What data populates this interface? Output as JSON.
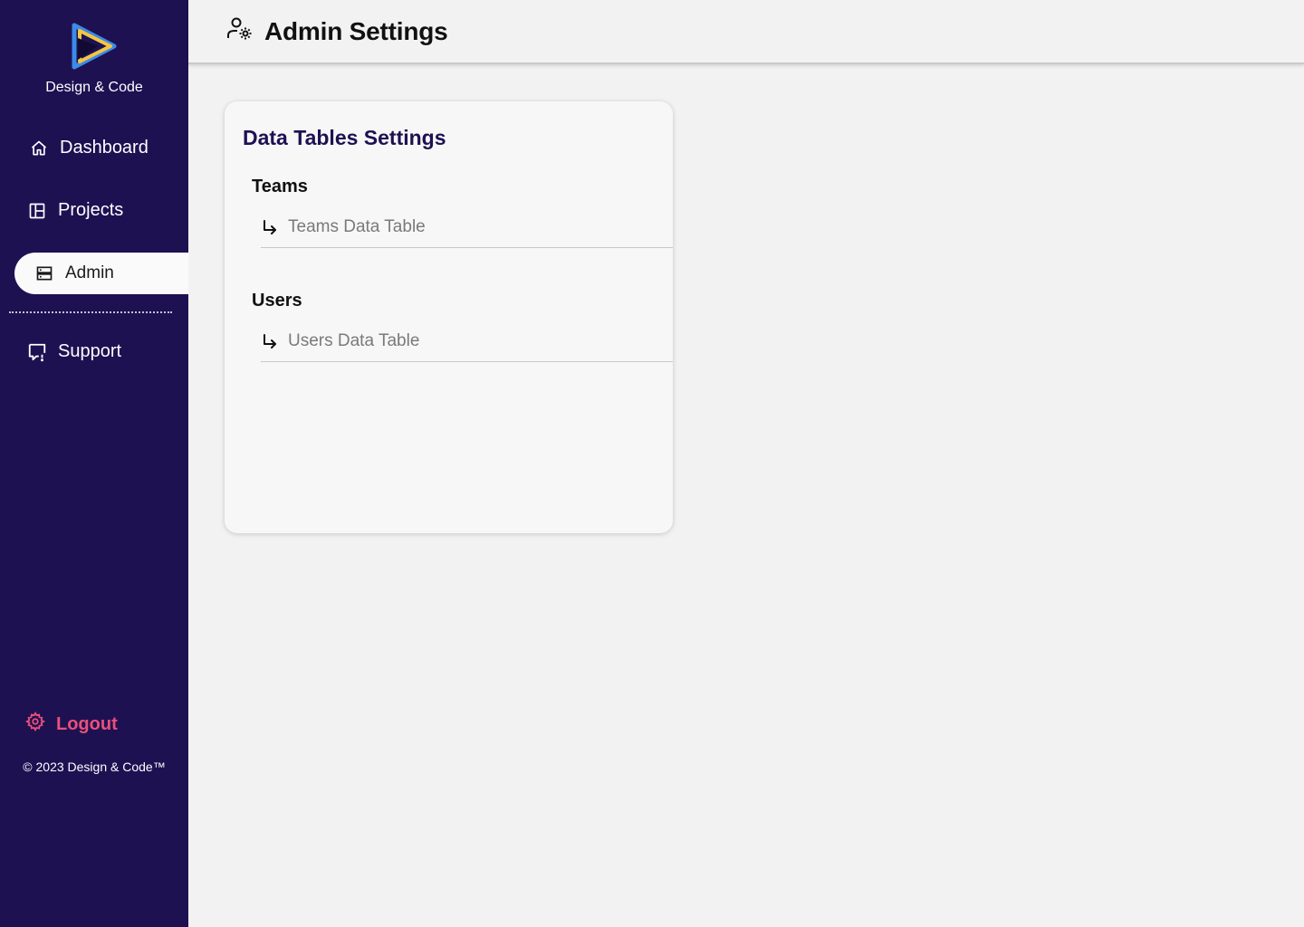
{
  "brand": {
    "name": "Design & Code",
    "logo": "play-triangle-logo"
  },
  "nav": {
    "items": [
      {
        "label": "Dashboard",
        "icon": "home-icon"
      },
      {
        "label": "Projects",
        "icon": "layout-icon"
      },
      {
        "label": "Admin",
        "icon": "server-icon",
        "active": true
      },
      {
        "label": "Support",
        "icon": "chat-help-icon"
      }
    ],
    "logout_label": "Logout",
    "logout_icon": "gear-icon"
  },
  "footer": {
    "copyright": "© 2023 Design & Code™"
  },
  "header": {
    "title": "Admin Settings",
    "icon": "user-gear-icon"
  },
  "card": {
    "title": "Data Tables Settings",
    "sections": [
      {
        "label": "Teams",
        "link_label": "Teams Data Table"
      },
      {
        "label": "Users",
        "link_label": "Users Data Table"
      }
    ]
  },
  "colors": {
    "sidebar_bg": "#1e1152",
    "accent_logout": "#e8507a",
    "card_title": "#1e1152",
    "logo_blue": "#3b8be8",
    "logo_yellow": "#f5c542"
  }
}
